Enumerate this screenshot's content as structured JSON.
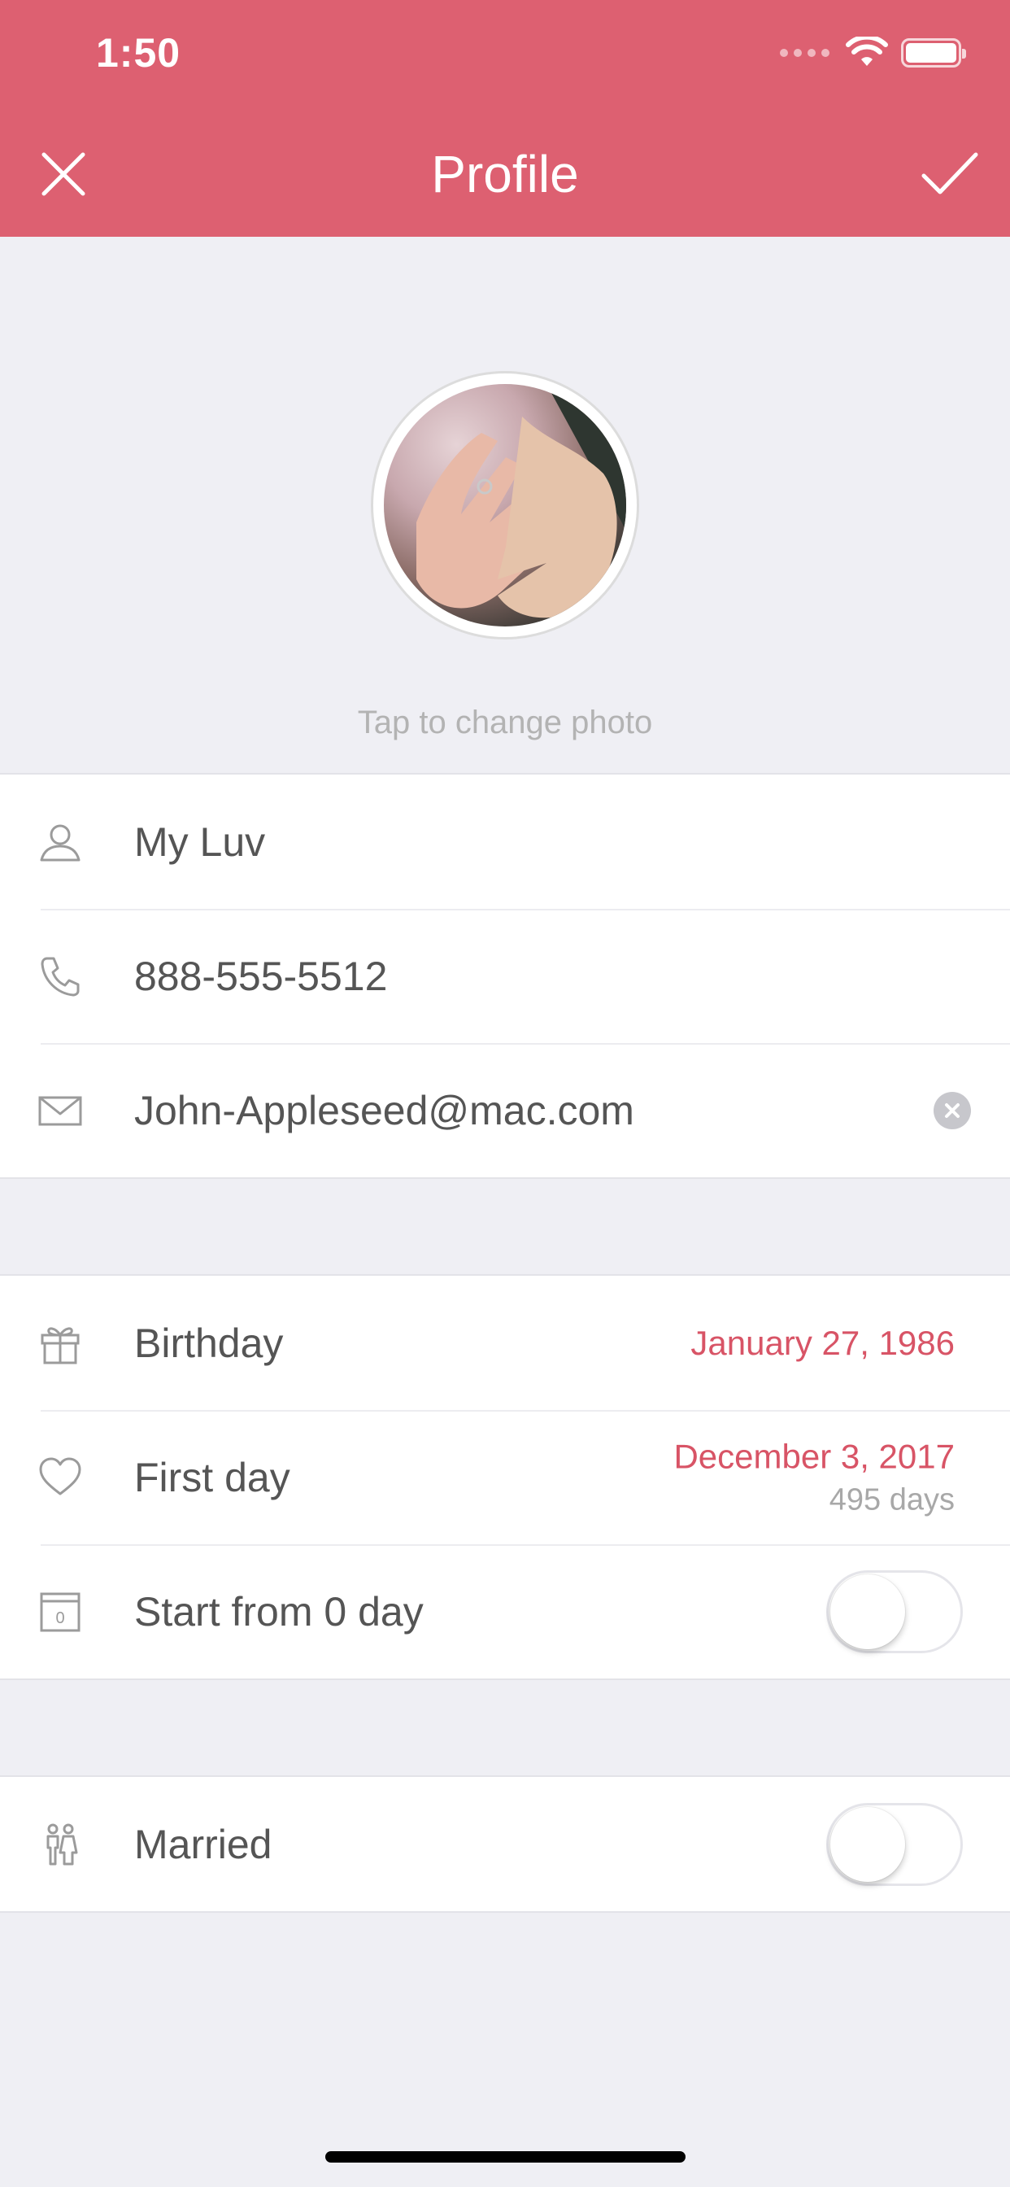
{
  "status_bar": {
    "time": "1:50"
  },
  "nav": {
    "title": "Profile"
  },
  "photo": {
    "hint": "Tap to change photo"
  },
  "contact": {
    "name": "My Luv",
    "phone": "888-555-5512",
    "email": "John-Appleseed@mac.com"
  },
  "dates": {
    "birthday_label": "Birthday",
    "birthday_value": "January 27, 1986",
    "first_day_label": "First day",
    "first_day_value": "December 3, 2017",
    "first_day_count": "495 days",
    "start_zero_label": "Start from 0 day",
    "start_zero_on": false,
    "start_zero_icon_text": "0"
  },
  "married": {
    "label": "Married",
    "on": false
  },
  "colors": {
    "accent": "#dd6071",
    "value_text": "#d85466",
    "background": "#efeff4"
  },
  "icons": [
    "close-icon",
    "checkmark-icon",
    "person-icon",
    "phone-icon",
    "mail-icon",
    "gift-icon",
    "heart-icon",
    "calendar-zero-icon",
    "couple-icon",
    "clear-icon",
    "wifi-icon",
    "battery-icon"
  ]
}
